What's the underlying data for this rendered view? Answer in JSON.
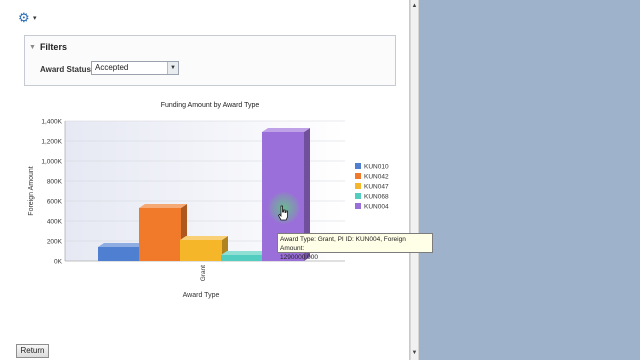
{
  "toolbar": {
    "gear_icon": "gear-icon",
    "caret": "▾"
  },
  "filters": {
    "title": "Filters",
    "toggle": "▼",
    "award_status_label": "Award Status",
    "award_status_value": "Accepted"
  },
  "tooltip": {
    "line1": "Award Type: Grant, PI ID: KUN004, Foreign Amount:",
    "line2": "1290000.000"
  },
  "return_label": "Return",
  "colors": {
    "KUN010": "#4f7fd1",
    "KUN042": "#f07a2a",
    "KUN047": "#f6b62a",
    "KUN068": "#52cdbf",
    "KUN004": "#9b6fd9"
  },
  "chart_data": {
    "type": "bar",
    "title": "Funding Amount by Award Type",
    "xlabel": "Award Type",
    "ylabel": "Foreign Amount",
    "categories": [
      "Grant"
    ],
    "ylim": [
      0,
      1400000
    ],
    "yticks": [
      0,
      200000,
      400000,
      600000,
      800000,
      1000000,
      1200000,
      1400000
    ],
    "ytick_labels": [
      "0K",
      "200K",
      "400K",
      "600K",
      "800K",
      "1,000K",
      "1,200K",
      "1,400K"
    ],
    "series": [
      {
        "name": "KUN010",
        "values": [
          140000
        ]
      },
      {
        "name": "KUN042",
        "values": [
          530000
        ]
      },
      {
        "name": "KUN047",
        "values": [
          210000
        ]
      },
      {
        "name": "KUN068",
        "values": [
          60000
        ]
      },
      {
        "name": "KUN004",
        "values": [
          1290000
        ]
      }
    ],
    "legend": "right",
    "grid": true
  }
}
